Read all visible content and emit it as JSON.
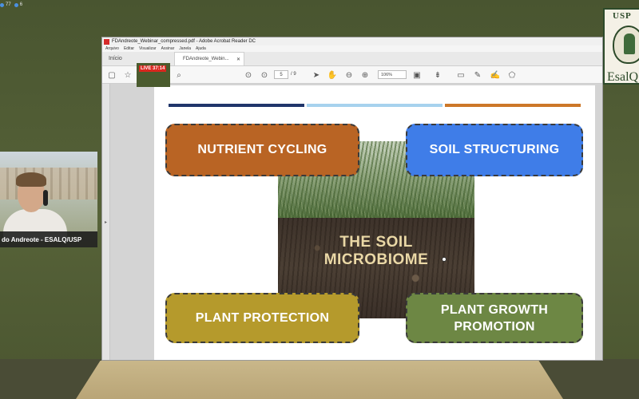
{
  "stats": {
    "viewers": "77",
    "likes": "6"
  },
  "logo": {
    "top": "USP",
    "bottom": "EsalQ"
  },
  "webcam": {
    "name_label": "do Andreote - ESALQ/USP"
  },
  "window": {
    "title": "FDAndreote_Webinar_compressed.pdf - Adobe Acrobat Reader DC",
    "menu": [
      "Arquivo",
      "Editar",
      "Visualizar",
      "Assinar",
      "Janela",
      "Ajuda"
    ],
    "tab_home": "Início",
    "tab_doc": "FDAndreote_Webin...",
    "live": "LIVE 37:14",
    "page_current": "5",
    "page_total": "/ 9",
    "zoom": "106%"
  },
  "slide": {
    "nutrient_cycling": "NUTRIENT CYCLING",
    "soil_structuring": "SOIL STRUCTURING",
    "plant_protection": "PLANT PROTECTION",
    "plant_growth_line1": "PLANT GROWTH",
    "plant_growth_line2": "PROMOTION",
    "center_line1": "THE SOIL",
    "center_line2": "MICROBIOME",
    "colors": {
      "nutrient": "#b96424",
      "structuring": "#3f7de8",
      "protection": "#b59a2c",
      "growth": "#6d8744"
    }
  }
}
